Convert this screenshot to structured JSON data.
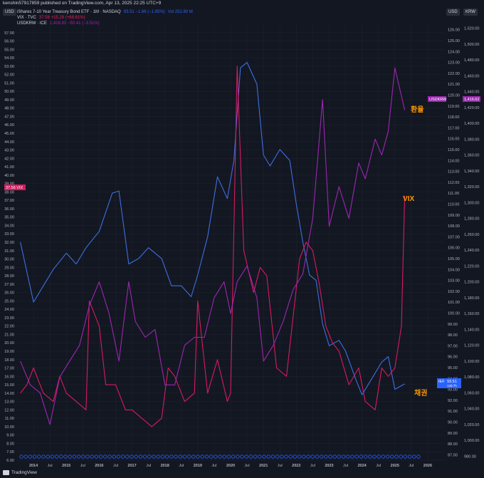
{
  "published": "kenshin57917859 published on TradingView.com, Apr 13, 2025 22:25 UTC+9",
  "legend": [
    {
      "name": "iShares 7-10 Year Treasury Bond ETF · 1M · NASDAQ",
      "values": "93.51 −1.66 (−1.65%)",
      "extra": "Vol 252.80 M",
      "color": "#2962ff"
    },
    {
      "name": "VIX · TVC",
      "values": "37.56 +15.28 (+68.61%)",
      "extra": "",
      "color": "#e91e63"
    },
    {
      "name": "USDKRW · ICE",
      "values": "1,416.63 −50.41 (−3.51%)",
      "extra": "",
      "color": "#9c27b0"
    }
  ],
  "axis_buttons": {
    "left": "USD",
    "right1": "USD",
    "right2": "KRW"
  },
  "annotations": {
    "fx": "환율",
    "vix": "VIX",
    "bond": "채권"
  },
  "badges": {
    "vix": "37.56 VIX",
    "usdkrw_label": "USDKRW",
    "usdkrw_value": "1,416.62",
    "ief_label": "IEF",
    "ief_value": "93.51",
    "ief_sub": "13d 7h"
  },
  "footer": {
    "brand": "TradingView"
  },
  "colors": {
    "bond": "#3d6fe0",
    "vix": "#d81b60",
    "fx": "#9c27b0",
    "accent": "#ff9800",
    "background": "#131722",
    "grid": "#232632"
  },
  "chart_data": {
    "type": "line",
    "x_ticks": [
      "2014",
      "Jul",
      "2015",
      "Jul",
      "2016",
      "Jul",
      "2017",
      "Jul",
      "2018",
      "Jul",
      "2019",
      "Jul",
      "2020",
      "Jul",
      "2021",
      "Jul",
      "2022",
      "Jul",
      "2023",
      "Jul",
      "2024",
      "Jul",
      "2025",
      "Jul",
      "2026"
    ],
    "x_range": [
      "2013-07",
      "2026-07"
    ],
    "left_axis": {
      "unit": "USD",
      "ylim": [
        6,
        58
      ],
      "ticks": [
        6.0,
        7.0,
        8.0,
        9.0,
        10.0,
        11.0,
        12.0,
        13.0,
        14.0,
        15.0,
        16.0,
        17.0,
        18.0,
        19.0,
        20.0,
        21.0,
        22.0,
        23.0,
        24.0,
        25.0,
        26.0,
        27.0,
        28.0,
        29.0,
        30.0,
        31.0,
        32.0,
        33.0,
        34.0,
        35.0,
        36.0,
        37.0,
        38.0,
        39.0,
        40.0,
        41.0,
        42.0,
        43.0,
        44.0,
        45.0,
        46.0,
        47.0,
        48.0,
        49.0,
        50.0,
        51.0,
        52.0,
        53.0,
        54.0,
        55.0,
        56.0,
        57.0
      ]
    },
    "bond_axis": {
      "unit": "USD",
      "ylim": [
        86.5,
        126.5
      ],
      "ticks": [
        87,
        88,
        89,
        90,
        91,
        92,
        93,
        94,
        95,
        96,
        97,
        98,
        99,
        100,
        101,
        102,
        103,
        104,
        105,
        106,
        107,
        108,
        109,
        110,
        111,
        112,
        113,
        114,
        115,
        116,
        117,
        118,
        119,
        120,
        121,
        122,
        123,
        124,
        125,
        126
      ]
    },
    "fx_axis": {
      "unit": "KRW",
      "ylim": [
        975,
        1525
      ],
      "ticks": [
        980,
        1000,
        1020,
        1040,
        1060,
        1080,
        1100,
        1120,
        1140,
        1160,
        1180,
        1200,
        1220,
        1240,
        1260,
        1280,
        1300,
        1320,
        1340,
        1360,
        1380,
        1400,
        1420,
        1440,
        1460,
        1480,
        1500,
        1520
      ]
    },
    "series": [
      {
        "name": "iShares 7-10 Year Treasury Bond ETF",
        "axis": "bond",
        "x": [
          2013.6,
          2014.0,
          2014.3,
          2014.6,
          2015.0,
          2015.3,
          2015.6,
          2016.0,
          2016.4,
          2016.6,
          2016.9,
          2017.2,
          2017.5,
          2017.9,
          2018.2,
          2018.5,
          2018.8,
          2019.0,
          2019.3,
          2019.6,
          2019.9,
          2020.1,
          2020.3,
          2020.5,
          2020.8,
          2021.0,
          2021.2,
          2021.5,
          2021.8,
          2022.0,
          2022.2,
          2022.4,
          2022.6,
          2022.8,
          2023.0,
          2023.3,
          2023.5,
          2023.8,
          2024.0,
          2024.3,
          2024.6,
          2024.8,
          2025.0,
          2025.3
        ],
        "y": [
          106.5,
          101.0,
          102.5,
          104.0,
          105.5,
          104.5,
          106.0,
          107.5,
          111.0,
          111.2,
          104.5,
          105.0,
          106.0,
          105.0,
          102.5,
          102.5,
          101.5,
          103.5,
          107.0,
          112.5,
          110.5,
          114.0,
          122.5,
          123.0,
          121.0,
          114.5,
          113.5,
          115.0,
          114.0,
          110.0,
          106.5,
          103.5,
          103.0,
          99.0,
          97.0,
          97.5,
          96.5,
          94.0,
          92.5,
          94.0,
          95.5,
          96.0,
          93.0,
          93.5
        ]
      },
      {
        "name": "VIX",
        "axis": "left",
        "x": [
          2013.6,
          2013.8,
          2014.0,
          2014.3,
          2014.6,
          2014.8,
          2015.0,
          2015.3,
          2015.6,
          2015.7,
          2016.0,
          2016.2,
          2016.5,
          2016.8,
          2017.0,
          2017.3,
          2017.6,
          2017.9,
          2018.1,
          2018.3,
          2018.6,
          2018.9,
          2019.0,
          2019.3,
          2019.6,
          2019.9,
          2020.0,
          2020.2,
          2020.4,
          2020.7,
          2020.9,
          2021.1,
          2021.4,
          2021.7,
          2021.9,
          2022.1,
          2022.3,
          2022.5,
          2022.7,
          2022.9,
          2023.1,
          2023.3,
          2023.6,
          2023.9,
          2024.1,
          2024.4,
          2024.6,
          2024.8,
          2025.0,
          2025.2,
          2025.3
        ],
        "y": [
          14,
          15,
          17,
          14,
          13,
          16,
          14,
          13,
          12,
          25,
          22,
          15,
          15,
          12,
          12,
          11,
          10,
          11,
          17,
          16,
          13,
          14,
          25,
          14,
          18,
          13,
          14,
          53,
          31,
          26,
          29,
          28,
          17,
          16,
          23,
          30,
          32,
          31,
          27,
          22,
          20,
          19,
          15,
          17,
          13,
          12,
          17,
          16,
          17,
          22,
          37.56
        ]
      },
      {
        "name": "USDKRW",
        "axis": "fx",
        "x": [
          2013.6,
          2013.9,
          2014.2,
          2014.5,
          2014.8,
          2015.1,
          2015.4,
          2015.7,
          2016.0,
          2016.3,
          2016.6,
          2016.9,
          2017.1,
          2017.4,
          2017.7,
          2018.0,
          2018.3,
          2018.6,
          2018.9,
          2019.2,
          2019.5,
          2019.8,
          2020.0,
          2020.2,
          2020.5,
          2020.8,
          2021.0,
          2021.3,
          2021.6,
          2021.9,
          2022.2,
          2022.5,
          2022.8,
          2023.0,
          2023.3,
          2023.6,
          2023.9,
          2024.1,
          2024.4,
          2024.6,
          2024.8,
          2025.0,
          2025.3
        ],
        "y": [
          1100,
          1070,
          1060,
          1020,
          1080,
          1100,
          1120,
          1170,
          1200,
          1160,
          1100,
          1200,
          1150,
          1130,
          1140,
          1070,
          1070,
          1120,
          1130,
          1130,
          1180,
          1200,
          1160,
          1200,
          1220,
          1180,
          1100,
          1120,
          1150,
          1190,
          1210,
          1280,
          1430,
          1270,
          1320,
          1280,
          1350,
          1330,
          1380,
          1360,
          1390,
          1470,
          1416.63
        ]
      }
    ]
  }
}
